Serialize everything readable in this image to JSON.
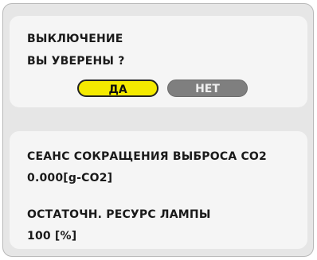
{
  "dialog": {
    "title": "ВЫКЛЮЧЕНИЕ",
    "question": "ВЫ УВЕРЕНЫ ?",
    "yes_label": "ДА",
    "no_label": "НЕТ"
  },
  "info": {
    "co2_label": "СЕАНС СОКРАЩЕНИЯ ВЫБРОСА CO2",
    "co2_value": "0.000[g-CO2]",
    "lamp_label": "ОСТАТОЧН. РЕСУРС ЛАМПЫ",
    "lamp_value": "100 [%]"
  },
  "colors": {
    "selected_button": "#f4ea00",
    "unselected_button": "#7f7f7f"
  }
}
